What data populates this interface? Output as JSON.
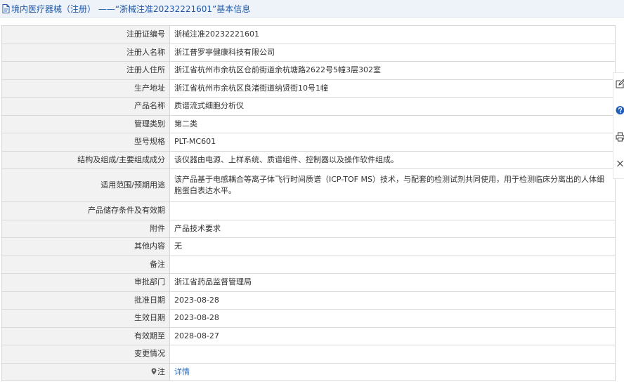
{
  "page": {
    "title": "境内医疗器械（注册） ——“浙械注准20232221601”基本信息"
  },
  "rows": [
    {
      "label": "注册证编号",
      "value": "浙械注准20232221601"
    },
    {
      "label": "注册人名称",
      "value": "浙江普罗亭健康科技有限公司"
    },
    {
      "label": "注册人住所",
      "value": "浙江省杭州市余杭区仓前街道余杭塘路2622号5幢3层302室"
    },
    {
      "label": "生产地址",
      "value": "浙江省杭州市余杭区良渚街道纳贤街10号1幢"
    },
    {
      "label": "产品名称",
      "value": "质谱流式细胞分析仪"
    },
    {
      "label": "管理类别",
      "value": "第二类"
    },
    {
      "label": "型号规格",
      "value": "PLT-MC601"
    },
    {
      "label": "结构及组成/主要组成成分",
      "value": "该仪器由电源、上样系统、质谱组件、控制器以及操作软件组成。"
    },
    {
      "label": "适用范围/预期用途",
      "value": "该产品基于电感耦合等离子体飞行时间质谱（ICP-TOF MS）技术，与配套的检测试剂共同使用，用于检测临床分离出的人体细胞蛋白表达水平。"
    },
    {
      "label": "产品储存条件及有效期",
      "value": ""
    },
    {
      "label": "附件",
      "value": "产品技术要求"
    },
    {
      "label": "其他内容",
      "value": "无"
    },
    {
      "label": "备注",
      "value": ""
    },
    {
      "label": "审批部门",
      "value": "浙江省药品监督管理局"
    },
    {
      "label": "批准日期",
      "value": "2023-08-28"
    },
    {
      "label": "生效日期",
      "value": "2023-08-28"
    },
    {
      "label": "有效期至",
      "value": "2028-08-27"
    },
    {
      "label": "变更情况",
      "value": ""
    },
    {
      "label": "注",
      "value": "详情"
    }
  ],
  "colors": {
    "title_text": "#1f57a6",
    "title_bar_bg": "#eef3fa",
    "label_bg": "#f2f2f2",
    "border": "#d8d8d8",
    "link": "#2a6fc9",
    "help_icon": "#1f5fbf"
  }
}
